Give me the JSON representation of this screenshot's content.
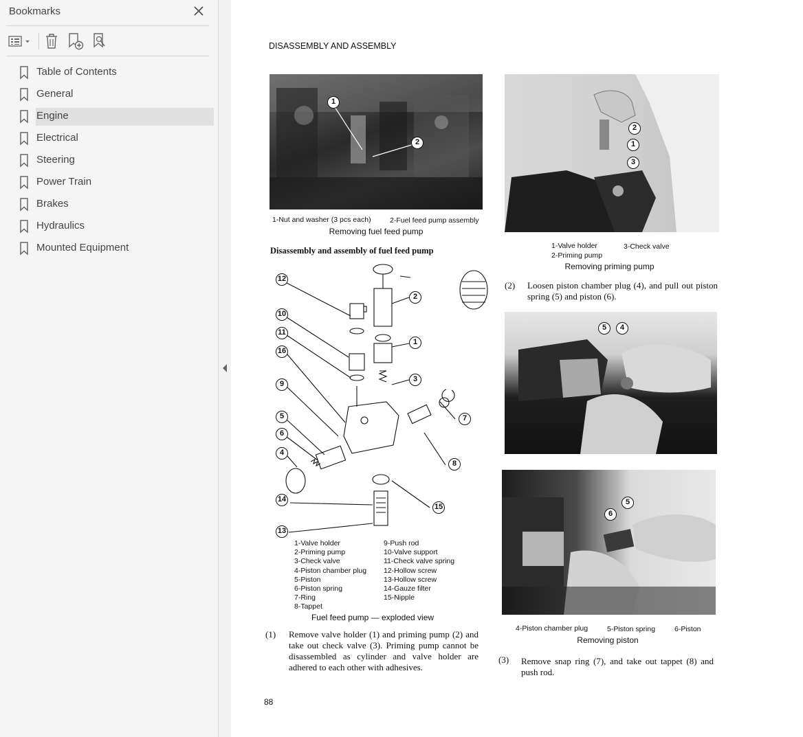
{
  "sidebar": {
    "title": "Bookmarks",
    "items": [
      {
        "label": "Table of Contents"
      },
      {
        "label": "General"
      },
      {
        "label": "Engine",
        "selected": true
      },
      {
        "label": "Electrical"
      },
      {
        "label": "Steering"
      },
      {
        "label": "Power Train"
      },
      {
        "label": "Brakes"
      },
      {
        "label": "Hydraulics"
      },
      {
        "label": "Mounted Equipment"
      }
    ],
    "toolbar_icons": [
      "options-list-icon",
      "delete-bookmark-icon",
      "new-bookmark-icon",
      "find-bookmark-icon"
    ]
  },
  "document": {
    "heading": "DISASSEMBLY AND ASSEMBLY",
    "page_number": "88",
    "fig1": {
      "caption_line": [
        "1-Nut and washer (3 pcs each)",
        "2-Fuel feed pump assembly"
      ],
      "title": "Removing fuel feed pump",
      "callouts": [
        "1",
        "2"
      ]
    },
    "section_title": "Disassembly and assembly of fuel feed pump",
    "exploded": {
      "callouts": [
        "12",
        "10",
        "11",
        "16",
        "9",
        "5",
        "6",
        "4",
        "14",
        "13",
        "2",
        "1",
        "3",
        "7",
        "8",
        "15"
      ],
      "parts_left": [
        "1-Valve holder",
        "2-Priming pump",
        "3-Check valve",
        "4-Piston chamber plug",
        "5-Piston",
        "6-Piston spring",
        "7-Ring",
        "8-Tappet"
      ],
      "parts_right": [
        "9-Push rod",
        "10-Valve support",
        "11-Check valve spring",
        "12-Hollow screw",
        "13-Hollow screw",
        "14-Gauze filter",
        "15-Nipple"
      ],
      "title": "Fuel feed pump — exploded view"
    },
    "step1": {
      "num": "(1)",
      "text": "Remove valve holder (1) and priming pump (2) and take out check valve (3). Priming pump cannot be disassembled as cylinder and valve holder are adhered to each other with adhesives."
    },
    "fig2": {
      "callouts": [
        "2",
        "1",
        "3"
      ],
      "caption_a": "1-Valve holder",
      "caption_b": "3-Check valve",
      "caption_c": "2-Priming pump",
      "title": "Removing priming pump"
    },
    "step2": {
      "num": "(2)",
      "text": "Loosen piston chamber plug (4), and pull out piston spring (5) and piston (6)."
    },
    "fig3": {
      "callouts": [
        "5",
        "4"
      ]
    },
    "fig4": {
      "callouts": [
        "5",
        "6"
      ],
      "caption_line": [
        "4-Piston chamber plug",
        "5-Piston spring",
        "6-Piston"
      ],
      "title": "Removing piston"
    },
    "step3": {
      "num": "(3)",
      "text": "Remove snap ring (7), and take out tappet (8) and push rod."
    }
  },
  "colors": {
    "sidebar_bg": "#f5f5f5",
    "selection_bg": "#e0e0e0",
    "icon": "#666666",
    "photo_dark": "#3a3a3a"
  }
}
